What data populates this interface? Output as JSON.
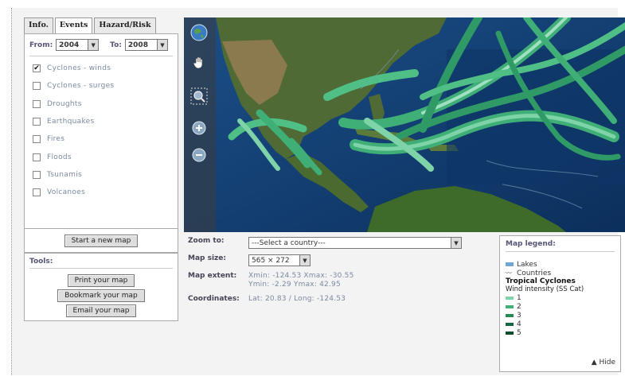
{
  "tabs": [
    {
      "label": "Info."
    },
    {
      "label": "Events"
    },
    {
      "label": "Hazard/Risk"
    }
  ],
  "dates": {
    "from_label": "From:",
    "from_value": "2004",
    "to_label": "To:",
    "to_value": "2008"
  },
  "events": [
    {
      "label": "Cyclones - winds",
      "checked": true
    },
    {
      "label": "Cyclones - surges",
      "checked": false
    },
    {
      "label": "Droughts",
      "checked": false
    },
    {
      "label": "Earthquakes",
      "checked": false
    },
    {
      "label": "Fires",
      "checked": false
    },
    {
      "label": "Floods",
      "checked": false
    },
    {
      "label": "Tsunamis",
      "checked": false
    },
    {
      "label": "Volcanoes",
      "checked": false
    }
  ],
  "start_button": "Start a new map",
  "tools": {
    "title": "Tools:",
    "buttons": [
      "Print your map",
      "Bookmark your map",
      "Email your map"
    ]
  },
  "info": {
    "zoom_label": "Zoom to:",
    "zoom_value": "---Select a country---",
    "size_label": "Map size:",
    "size_value": "565 × 272",
    "extent_label": "Map extent:",
    "extent_line1": "Xmin: -124.53 Xmax: -30.55",
    "extent_line2": "Ymin: -2.29 Ymax: 42.95",
    "coords_label": "Coordinates:",
    "coords_value": "Lat: 20.83 / Long: -124.53"
  },
  "legend": {
    "title": "Map legend:",
    "lakes": "Lakes",
    "countries": "Countries",
    "cyclones_heading": "Tropical Cyclones",
    "intensity_heading": "Wind intensity (SS Cat)",
    "categories": [
      {
        "label": "1",
        "color": "#7ed3a8"
      },
      {
        "label": "2",
        "color": "#3fae77"
      },
      {
        "label": "3",
        "color": "#238a55"
      },
      {
        "label": "4",
        "color": "#136b3d"
      },
      {
        "label": "5",
        "color": "#0a4d2a"
      }
    ],
    "hide_label": "▲ Hide"
  },
  "icons": {
    "globe": "globe-icon",
    "pan": "hand-pan-icon",
    "zoom_box": "zoom-box-icon",
    "zoom_in": "zoom-in-icon",
    "zoom_out": "zoom-out-icon"
  }
}
